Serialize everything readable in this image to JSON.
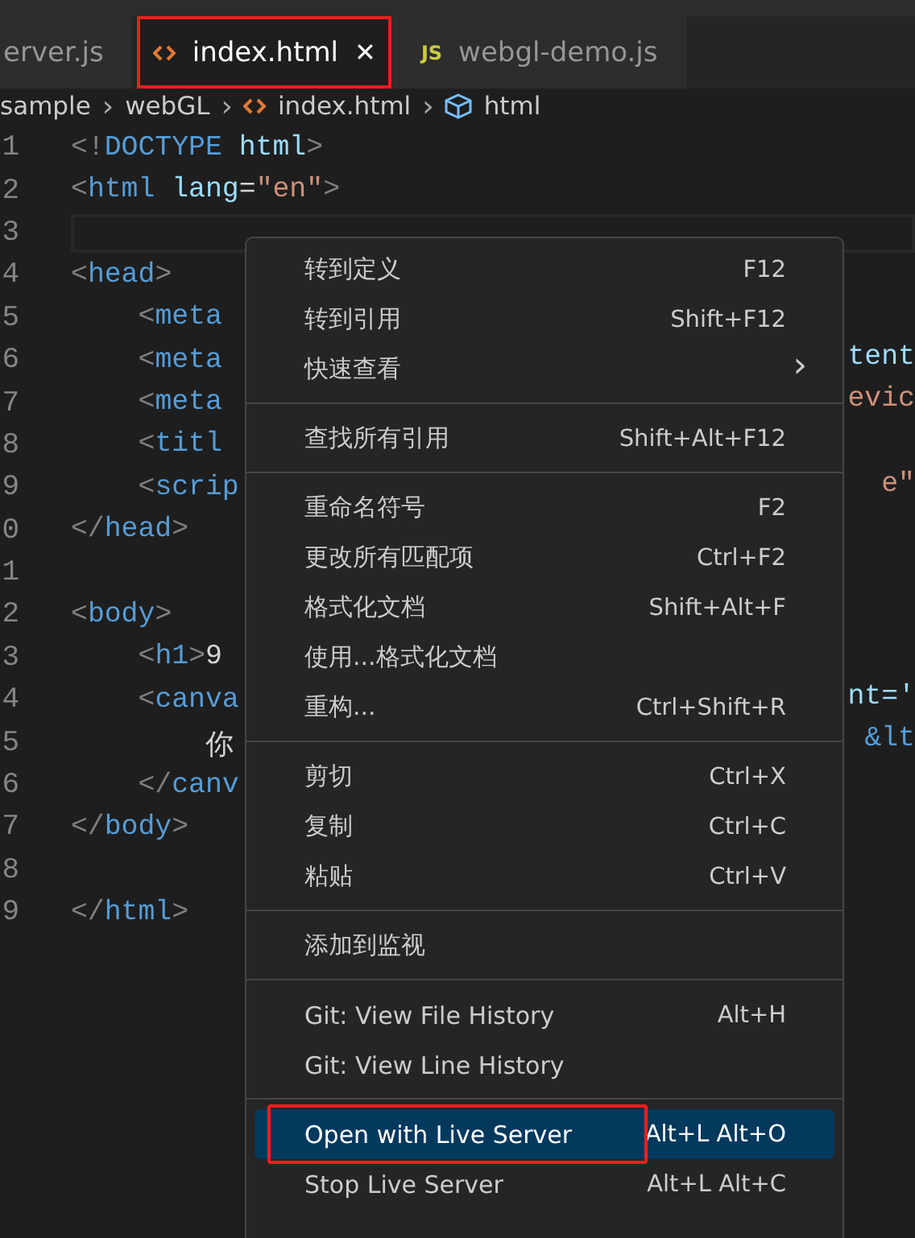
{
  "tabs": [
    {
      "label": "erver.js",
      "kind": "plain",
      "selected": false
    },
    {
      "label": "index.html",
      "kind": "markup",
      "selected": true,
      "close": "✕"
    },
    {
      "label": "webgl-demo.js",
      "kind": "script",
      "badge": "JS",
      "selected": false
    }
  ],
  "breadcrumb": [
    {
      "label": "sample",
      "kind": "folder"
    },
    {
      "label": "webGL",
      "kind": "folder"
    },
    {
      "label": "index.html",
      "kind": "file"
    },
    {
      "label": "html",
      "kind": "symbol"
    }
  ],
  "breadcrumb_separator": "›",
  "code_lines": [
    {
      "number": "1",
      "current": false,
      "tokens": [
        {
          "text": "<!",
          "kind": "punct"
        },
        {
          "text": "DOCTYPE",
          "kind": "tag"
        },
        {
          "text": " html",
          "kind": "attr"
        },
        {
          "text": ">",
          "kind": "punct"
        }
      ]
    },
    {
      "number": "2",
      "current": false,
      "tokens": [
        {
          "text": "<",
          "kind": "punct"
        },
        {
          "text": "html",
          "kind": "tag"
        },
        {
          "text": " lang",
          "kind": "attr"
        },
        {
          "text": "=",
          "kind": "plain"
        },
        {
          "text": "\"en\"",
          "kind": "string"
        },
        {
          "text": ">",
          "kind": "punct"
        }
      ]
    },
    {
      "number": "3",
      "current": true
    },
    {
      "number": "4",
      "current": false,
      "tokens": [
        {
          "text": "<",
          "kind": "punct"
        },
        {
          "text": "head",
          "kind": "tag"
        },
        {
          "text": ">",
          "kind": "punct"
        }
      ]
    },
    {
      "number": "5",
      "current": false,
      "tokens": [
        {
          "text": "    <",
          "kind": "punct"
        },
        {
          "text": "meta",
          "kind": "tag"
        }
      ]
    },
    {
      "number": "6",
      "current": false,
      "tokens": [
        {
          "text": "    <",
          "kind": "punct"
        },
        {
          "text": "meta",
          "kind": "tag"
        }
      ],
      "tail": {
        "text": "tent",
        "kind": "attr"
      }
    },
    {
      "number": "7",
      "current": false,
      "tokens": [
        {
          "text": "    <",
          "kind": "punct"
        },
        {
          "text": "meta",
          "kind": "tag"
        }
      ],
      "tail": {
        "text": "evic",
        "kind": "string"
      }
    },
    {
      "number": "8",
      "current": false,
      "tokens": [
        {
          "text": "    <",
          "kind": "punct"
        },
        {
          "text": "titl",
          "kind": "tag"
        }
      ]
    },
    {
      "number": "9",
      "current": false,
      "tokens": [
        {
          "text": "    <",
          "kind": "punct"
        },
        {
          "text": "scrip",
          "kind": "tag"
        }
      ],
      "tail": {
        "text": "e\"",
        "kind": "string"
      }
    },
    {
      "number": "0",
      "current": false,
      "tokens": [
        {
          "text": "</",
          "kind": "punct"
        },
        {
          "text": "head",
          "kind": "tag"
        },
        {
          "text": ">",
          "kind": "punct"
        }
      ]
    },
    {
      "number": "1",
      "current": false
    },
    {
      "number": "2",
      "current": false,
      "tokens": [
        {
          "text": "<",
          "kind": "punct"
        },
        {
          "text": "body",
          "kind": "tag"
        },
        {
          "text": ">",
          "kind": "punct"
        }
      ]
    },
    {
      "number": "3",
      "current": false,
      "tokens": [
        {
          "text": "    <",
          "kind": "punct"
        },
        {
          "text": "h1",
          "kind": "tag"
        },
        {
          "text": ">",
          "kind": "punct"
        },
        {
          "text": "9",
          "kind": "plain"
        }
      ]
    },
    {
      "number": "4",
      "current": false,
      "tokens": [
        {
          "text": "    <",
          "kind": "punct"
        },
        {
          "text": "canva",
          "kind": "tag"
        }
      ],
      "tail": {
        "text": "nt='",
        "kind": "attr"
      }
    },
    {
      "number": "5",
      "current": false,
      "tokens": [
        {
          "text": "        你",
          "kind": "plain"
        }
      ],
      "tail": {
        "text": "&lt",
        "kind": "tag"
      }
    },
    {
      "number": "6",
      "current": false,
      "tokens": [
        {
          "text": "    </",
          "kind": "punct"
        },
        {
          "text": "canv",
          "kind": "tag"
        }
      ]
    },
    {
      "number": "7",
      "current": false,
      "tokens": [
        {
          "text": "</",
          "kind": "punct"
        },
        {
          "text": "body",
          "kind": "tag"
        },
        {
          "text": ">",
          "kind": "punct"
        }
      ]
    },
    {
      "number": "8",
      "current": false
    },
    {
      "number": "9",
      "current": false,
      "tokens": [
        {
          "text": "</",
          "kind": "punct"
        },
        {
          "text": "html",
          "kind": "tag"
        },
        {
          "text": ">",
          "kind": "punct"
        }
      ]
    }
  ],
  "context_menu": [
    {
      "kind": "item",
      "label": "转到定义",
      "shortcut": "F12",
      "selected": false
    },
    {
      "kind": "item",
      "label": "转到引用",
      "shortcut": "Shift+F12",
      "selected": false
    },
    {
      "kind": "item",
      "label": "快速查看",
      "arrow": "›",
      "selected": false
    },
    {
      "kind": "separator"
    },
    {
      "kind": "item",
      "label": "查找所有引用",
      "shortcut": "Shift+Alt+F12",
      "selected": false
    },
    {
      "kind": "separator"
    },
    {
      "kind": "item",
      "label": "重命名符号",
      "shortcut": "F2",
      "selected": false
    },
    {
      "kind": "item",
      "label": "更改所有匹配项",
      "shortcut": "Ctrl+F2",
      "selected": false
    },
    {
      "kind": "item",
      "label": "格式化文档",
      "shortcut": "Shift+Alt+F",
      "selected": false
    },
    {
      "kind": "item",
      "label": "使用...格式化文档",
      "selected": false
    },
    {
      "kind": "item",
      "label": "重构...",
      "shortcut": "Ctrl+Shift+R",
      "selected": false
    },
    {
      "kind": "separator"
    },
    {
      "kind": "item",
      "label": "剪切",
      "shortcut": "Ctrl+X",
      "selected": false
    },
    {
      "kind": "item",
      "label": "复制",
      "shortcut": "Ctrl+C",
      "selected": false
    },
    {
      "kind": "item",
      "label": "粘贴",
      "shortcut": "Ctrl+V",
      "selected": false
    },
    {
      "kind": "separator"
    },
    {
      "kind": "item",
      "label": "添加到监视",
      "selected": false
    },
    {
      "kind": "separator"
    },
    {
      "kind": "item",
      "label": "Git: View File History",
      "shortcut": "Alt+H",
      "selected": false
    },
    {
      "kind": "item",
      "label": "Git: View Line History",
      "selected": false
    },
    {
      "kind": "separator"
    },
    {
      "kind": "item",
      "label": "Open with Live Server",
      "shortcut": "Alt+L Alt+O",
      "selected": true,
      "highlighted": true
    },
    {
      "kind": "item",
      "label": "Stop Live Server",
      "shortcut": "Alt+L Alt+C",
      "selected": false
    }
  ]
}
